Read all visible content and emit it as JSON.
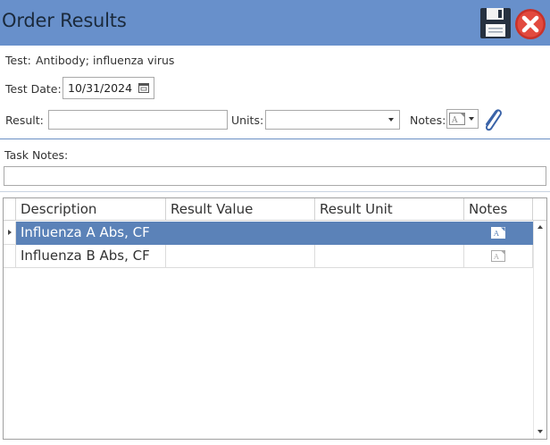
{
  "window": {
    "title": "Order Results",
    "accent_color": "#6890cb",
    "save_icon": "floppy-disk-icon",
    "close_icon": "red-x-close-icon"
  },
  "test": {
    "label": "Test:",
    "value": "Antibody; influenza virus"
  },
  "test_date": {
    "label": "Test Date:",
    "value": "10/31/2024",
    "icon": "calendar-icon"
  },
  "result": {
    "label": "Result:",
    "value": ""
  },
  "units": {
    "label": "Units:",
    "value": ""
  },
  "notes": {
    "label": "Notes:",
    "icon": "note-icon",
    "attach_icon": "paperclip-icon"
  },
  "task_notes": {
    "label": "Task Notes:",
    "value": ""
  },
  "grid": {
    "columns": [
      "Description",
      "Result Value",
      "Result Unit",
      "Notes"
    ],
    "rows": [
      {
        "description": "Influenza A Abs, CF",
        "result_value": "",
        "result_unit": "",
        "selected": true
      },
      {
        "description": "Influenza B Abs, CF",
        "result_value": "",
        "result_unit": "",
        "selected": false
      }
    ],
    "selection_color": "#5b82b8"
  }
}
